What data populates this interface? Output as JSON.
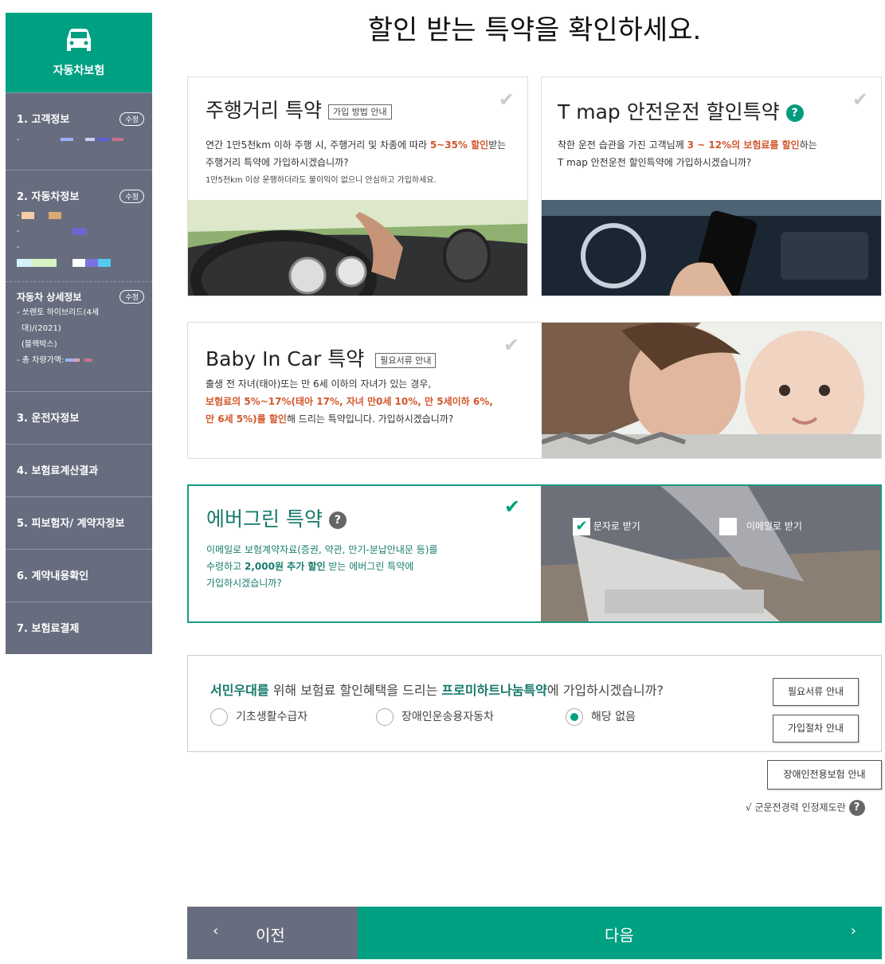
{
  "sidebar": {
    "product": "자동차보험",
    "edit_label": "수정",
    "sections": [
      {
        "label": "1. 고객정보"
      },
      {
        "label": "2. 자동차정보",
        "detail_title": "자동차 상세정보",
        "detail_lines": [
          "- 쏘렌토 하이브리드(4세",
          "대)/(2021)",
          "(블랙박스)",
          "- 총 차량가액:"
        ]
      },
      {
        "label": "3. 운전자정보"
      },
      {
        "label": "4. 보험료계산결과"
      },
      {
        "label": "5. 피보험자/ 계약자정보"
      },
      {
        "label": "6. 계약내용확인"
      },
      {
        "label": "7. 보험료결제"
      }
    ]
  },
  "main": {
    "title": "할인 받는 특약을 확인하세요.",
    "mileage": {
      "title": "주행거리 특약",
      "btn": "가입 방법 안내",
      "desc1": "연간 1만5천km 이하 주행 시, 주행거리 및 차종에 따라 ",
      "desc_red": "5~35% 할인",
      "desc2": "받는 주행거리 특약에 가입하시겠습니까?",
      "note": "1만5천km 이상 운행하더라도 불이익이 없으니 안심하고 가입하세요."
    },
    "tmap": {
      "title": "T map 안전운전 할인특약",
      "desc1": "착한 운전 습관을 가진 고객님께 ",
      "desc_red": "3 ~ 12%의 보험료를 할인",
      "desc2": "하는",
      "desc3": "T map 안전운전 할인특약에 가입하시겠습니까?"
    },
    "baby": {
      "title": "Baby In Car 특약",
      "btn": "필요서류 안내",
      "desc1": "출생 전 자녀(태아)또는 만 6세 이하의 자녀가 있는 경우,",
      "desc_red1": "보험료의 5%~17%(태아 17%, 자녀 만0세 10%, 만 5세이하 6%,",
      "desc_red2": "만 6세 5%)를 할인",
      "desc2": "해 드리는 특약입니다. 가입하시겠습니까?"
    },
    "evergreen": {
      "title": "에버그린 특약",
      "desc1": "이메일로 보험계약자료(증권, 약관, 만기-분납안내문 등)를",
      "desc2a": "수령하고 ",
      "desc2b": "2,000원 추가 할인",
      "desc2c": " 받는 에버그린 특약에",
      "desc3": "가입하시겠습니까?",
      "opt_sms": "문자로 받기",
      "opt_email": "이메일로 받기"
    },
    "special": {
      "q_b1": "서민우대를",
      "q_mid": " 위해 보험료 할인혜택을 드리는 ",
      "q_b2": "프로미하트나눔특약",
      "q_end": "에 가입하시겠습니까?",
      "opt1": "기초생활수급자",
      "opt2": "장애인운송용자동차",
      "opt3": "해당 없음",
      "btn1": "필요서류 안내",
      "btn2": "가입절차 안내"
    },
    "disabled_btn": "장애인전용보험 안내",
    "military_link": "√ 군운전경력 인정제도란",
    "prev": "이전",
    "next": "다음"
  }
}
